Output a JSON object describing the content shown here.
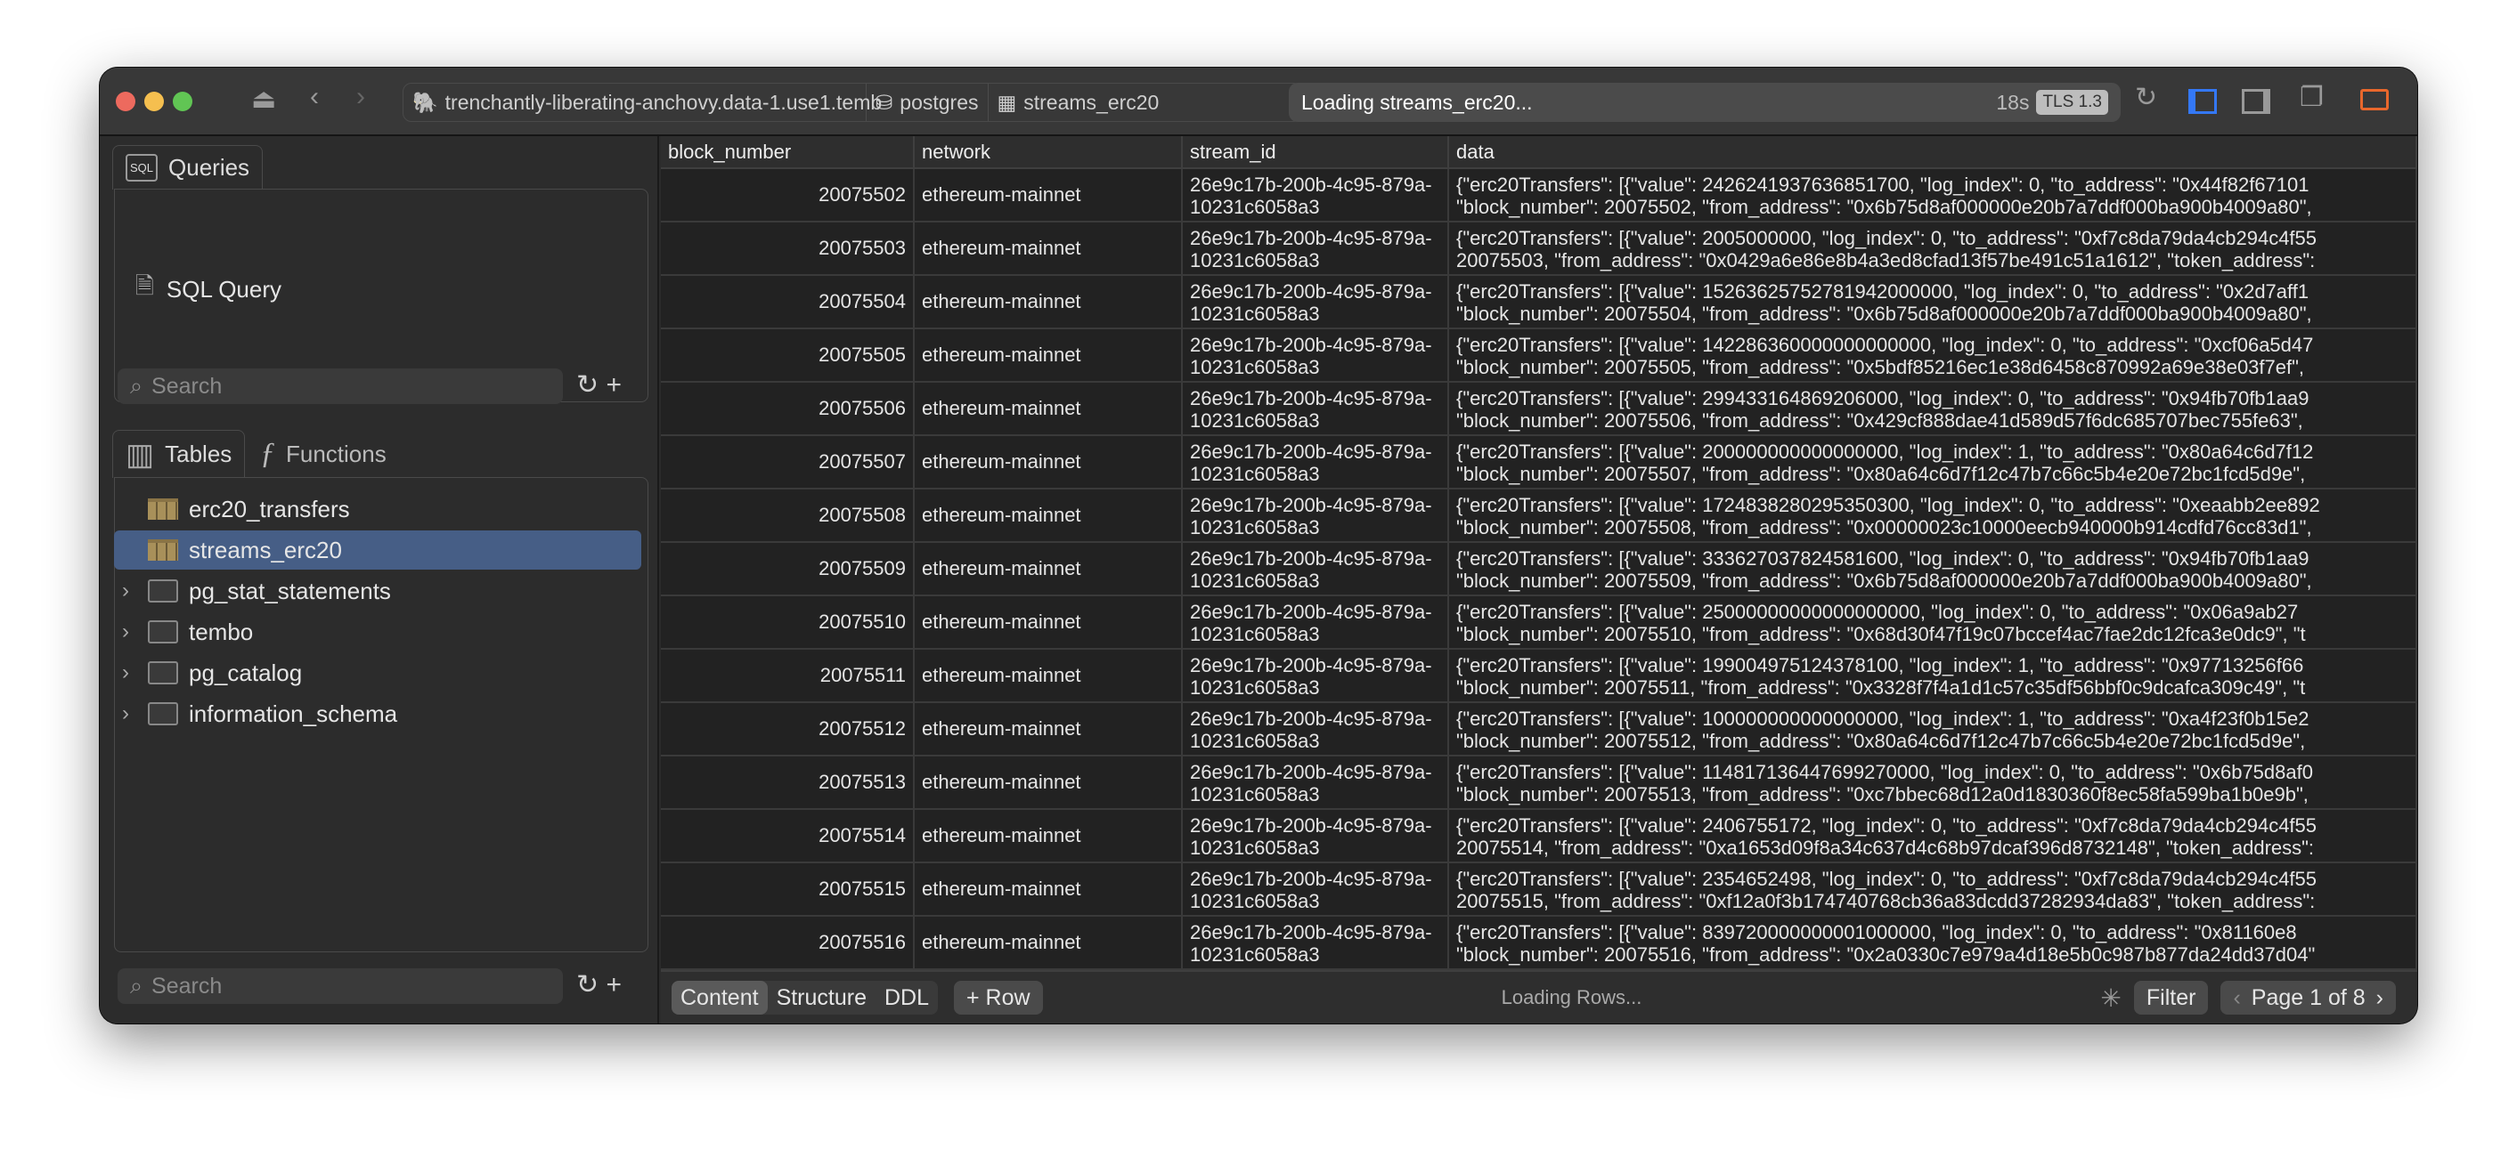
{
  "window": {
    "traffic_colors": [
      "#ed6a5e",
      "#f5bf4f",
      "#61c554"
    ]
  },
  "toolbar": {
    "connection": "trenchantly-liberating-anchovy.data-1.use1.temb",
    "database": "postgres",
    "table": "streams_erc20",
    "status": "Loading streams_erc20...",
    "elapsed": "18s",
    "tls": "TLS 1.3",
    "accent": "#3478f6",
    "alert": "#e8672c"
  },
  "sidebar": {
    "queries_tab": "Queries",
    "sql_badge": "SQL",
    "query_item": "SQL Query",
    "search_placeholder": "Search",
    "tables_tab": "Tables",
    "functions_tab": "Functions",
    "items": [
      {
        "label": "erc20_transfers",
        "icon": "table-icon",
        "expandable": false
      },
      {
        "label": "streams_erc20",
        "icon": "table-icon",
        "expandable": false,
        "selected": true
      },
      {
        "label": "pg_stat_statements",
        "icon": "extension-icon",
        "expandable": true
      },
      {
        "label": "tembo",
        "icon": "folder-icon",
        "expandable": true
      },
      {
        "label": "pg_catalog",
        "icon": "folder-icon",
        "expandable": true
      },
      {
        "label": "information_schema",
        "icon": "folder-icon",
        "expandable": true
      }
    ],
    "bottom_search_placeholder": "Search"
  },
  "grid": {
    "columns": [
      "block_number",
      "network",
      "stream_id",
      "data"
    ],
    "rows": [
      [
        "20075502",
        "ethereum-mainnet",
        "26e9c17b-200b-4c95-879a-10231c6058a3",
        "{\"erc20Transfers\": [{\"value\": 2426241937636851700, \"log_index\": 0, \"to_address\": \"0x44f82f67101",
        "\"block_number\": 20075502, \"from_address\": \"0x6b75d8af000000e20b7a7ddf000ba900b4009a80\","
      ],
      [
        "20075503",
        "ethereum-mainnet",
        "26e9c17b-200b-4c95-879a-10231c6058a3",
        "{\"erc20Transfers\": [{\"value\": 2005000000, \"log_index\": 0, \"to_address\": \"0xf7c8da79da4cb294c4f55",
        "20075503, \"from_address\": \"0x0429a6e86e8b4a3ed8cfad13f57be491c51a1612\", \"token_address\":"
      ],
      [
        "20075504",
        "ethereum-mainnet",
        "26e9c17b-200b-4c95-879a-10231c6058a3",
        "{\"erc20Transfers\": [{\"value\": 15263625752781942000000, \"log_index\": 0, \"to_address\": \"0x2d7aff1",
        "\"block_number\": 20075504, \"from_address\": \"0x6b75d8af000000e20b7a7ddf000ba900b4009a80\","
      ],
      [
        "20075505",
        "ethereum-mainnet",
        "26e9c17b-200b-4c95-879a-10231c6058a3",
        "{\"erc20Transfers\": [{\"value\": 142286360000000000000, \"log_index\": 0, \"to_address\": \"0xcf06a5d47",
        "\"block_number\": 20075505, \"from_address\": \"0x5bdf85216ec1e38d6458c870992a69e38e03f7ef\","
      ],
      [
        "20075506",
        "ethereum-mainnet",
        "26e9c17b-200b-4c95-879a-10231c6058a3",
        "{\"erc20Transfers\": [{\"value\": 299433164869206000, \"log_index\": 0, \"to_address\": \"0x94fb70fb1aa9",
        "\"block_number\": 20075506, \"from_address\": \"0x429cf888dae41d589d57f6dc685707bec755fe63\","
      ],
      [
        "20075507",
        "ethereum-mainnet",
        "26e9c17b-200b-4c95-879a-10231c6058a3",
        "{\"erc20Transfers\": [{\"value\": 200000000000000000, \"log_index\": 1, \"to_address\": \"0x80a64c6d7f12",
        "\"block_number\": 20075507, \"from_address\": \"0x80a64c6d7f12c47b7c66c5b4e20e72bc1fcd5d9e\","
      ],
      [
        "20075508",
        "ethereum-mainnet",
        "26e9c17b-200b-4c95-879a-10231c6058a3",
        "{\"erc20Transfers\": [{\"value\": 1724838280295350300, \"log_index\": 0, \"to_address\": \"0xeaabb2ee892",
        "\"block_number\": 20075508, \"from_address\": \"0x00000023c10000eecb940000b914cdfd76cc83d1\","
      ],
      [
        "20075509",
        "ethereum-mainnet",
        "26e9c17b-200b-4c95-879a-10231c6058a3",
        "{\"erc20Transfers\": [{\"value\": 333627037824581600, \"log_index\": 0, \"to_address\": \"0x94fb70fb1aa9",
        "\"block_number\": 20075509, \"from_address\": \"0x6b75d8af000000e20b7a7ddf000ba900b4009a80\","
      ],
      [
        "20075510",
        "ethereum-mainnet",
        "26e9c17b-200b-4c95-879a-10231c6058a3",
        "{\"erc20Transfers\": [{\"value\": 25000000000000000000, \"log_index\": 0, \"to_address\": \"0x06a9ab27",
        "\"block_number\": 20075510, \"from_address\": \"0x68d30f47f19c07bccef4ac7fae2dc12fca3e0dc9\", \"t"
      ],
      [
        "20075511",
        "ethereum-mainnet",
        "26e9c17b-200b-4c95-879a-10231c6058a3",
        "{\"erc20Transfers\": [{\"value\": 199004975124378100, \"log_index\": 1, \"to_address\": \"0x97713256f66",
        "\"block_number\": 20075511, \"from_address\": \"0x3328f7f4a1d1c57c35df56bbf0c9dcafca309c49\", \"t"
      ],
      [
        "20075512",
        "ethereum-mainnet",
        "26e9c17b-200b-4c95-879a-10231c6058a3",
        "{\"erc20Transfers\": [{\"value\": 100000000000000000, \"log_index\": 1, \"to_address\": \"0xa4f23f0b15e2",
        "\"block_number\": 20075512, \"from_address\": \"0x80a64c6d7f12c47b7c66c5b4e20e72bc1fcd5d9e\","
      ],
      [
        "20075513",
        "ethereum-mainnet",
        "26e9c17b-200b-4c95-879a-10231c6058a3",
        "{\"erc20Transfers\": [{\"value\": 114817136447699270000, \"log_index\": 0, \"to_address\": \"0x6b75d8af0",
        "\"block_number\": 20075513, \"from_address\": \"0xc7bbec68d12a0d1830360f8ec58fa599ba1b0e9b\","
      ],
      [
        "20075514",
        "ethereum-mainnet",
        "26e9c17b-200b-4c95-879a-10231c6058a3",
        "{\"erc20Transfers\": [{\"value\": 2406755172, \"log_index\": 0, \"to_address\": \"0xf7c8da79da4cb294c4f55",
        "20075514, \"from_address\": \"0xa1653d09f8a34c637d4c68b97dcaf396d8732148\", \"token_address\":"
      ],
      [
        "20075515",
        "ethereum-mainnet",
        "26e9c17b-200b-4c95-879a-10231c6058a3",
        "{\"erc20Transfers\": [{\"value\": 2354652498, \"log_index\": 0, \"to_address\": \"0xf7c8da79da4cb294c4f55",
        "20075515, \"from_address\": \"0xf12a0f3b174740768cb36a83dcdd37282934da83\", \"token_address\":"
      ],
      [
        "20075516",
        "ethereum-mainnet",
        "26e9c17b-200b-4c95-879a-10231c6058a3",
        "{\"erc20Transfers\": [{\"value\": 839720000000001000000, \"log_index\": 0, \"to_address\": \"0x81160e8",
        "\"block_number\": 20075516, \"from_address\": \"0x2a0330c7e979a4d18e5b0c987b877da24dd37d04\""
      ]
    ]
  },
  "footer": {
    "tabs": [
      "Content",
      "Structure",
      "DDL"
    ],
    "add_row": "+ Row",
    "status": "Loading Rows...",
    "filter": "Filter",
    "page": "Page 1 of 8"
  }
}
